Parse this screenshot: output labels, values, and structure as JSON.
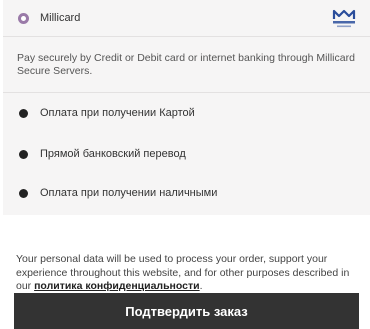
{
  "payment": {
    "selected_method": {
      "label": "Millicard",
      "logo_icon": "millicard-logo",
      "description": "Pay securely by Credit or Debit card or internet banking through Millicard Secure Servers."
    },
    "other_methods": [
      {
        "label": "Оплата при получении Картой"
      },
      {
        "label": "Прямой банковский перевод"
      },
      {
        "label": "Оплата при получении наличными"
      }
    ]
  },
  "privacy": {
    "text": "Your personal data will be used to process your order, support your experience throughout this website, and for other purposes described in our ",
    "link_label": "политика конфиденциальности",
    "suffix": "."
  },
  "submit": {
    "label": "Подтвердить заказ"
  },
  "colors": {
    "accent_radio": "#9a7aa8",
    "button_bg": "#333333",
    "panel_bg": "#f6f5f5",
    "logo_blue": "#2a4d9b"
  }
}
